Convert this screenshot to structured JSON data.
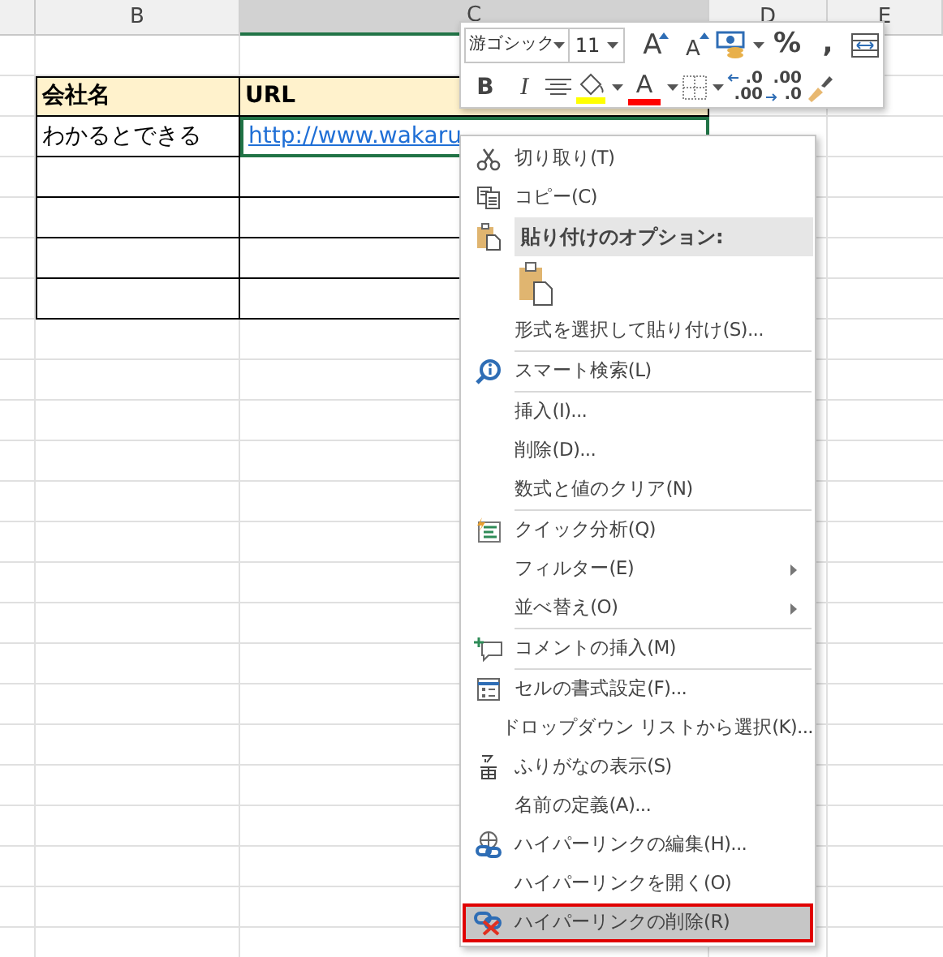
{
  "sheet": {
    "columns": [
      {
        "label": "B",
        "selected": false
      },
      {
        "label": "C",
        "selected": true
      },
      {
        "label": "D",
        "selected": false
      },
      {
        "label": "E",
        "selected": false
      }
    ],
    "table": {
      "header": [
        "会社名",
        "URL"
      ],
      "rows": [
        {
          "company": "わかるとできる",
          "url": "http://www.wakaru",
          "selected": true
        }
      ]
    }
  },
  "mini_toolbar": {
    "font": "游ゴシック",
    "size": "11",
    "row_1": [
      {
        "kind": "grow",
        "label": "A"
      },
      {
        "kind": "shrink",
        "label": "A"
      },
      {
        "kind": "accounting"
      },
      {
        "kind": "text",
        "label": "%"
      },
      {
        "kind": "text",
        "label": ","
      },
      {
        "kind": "wrap"
      }
    ],
    "row_2": [
      {
        "kind": "bold",
        "label": "B"
      },
      {
        "kind": "italic",
        "label": "I"
      },
      {
        "kind": "align"
      },
      {
        "kind": "fill",
        "color": "#ffff00"
      },
      {
        "kind": "fontcolor",
        "label": "A",
        "color": "#ff0000"
      },
      {
        "kind": "borders"
      },
      {
        "kind": "decimal-more",
        "top": ".0",
        "bottom": ".00"
      },
      {
        "kind": "decimal-less",
        "top": ".00",
        "bottom": ".0"
      },
      {
        "kind": "painter"
      }
    ]
  },
  "context_menu": [
    {
      "kind": "item",
      "label": "切り取り(T)",
      "selected": false
    },
    {
      "kind": "item",
      "label": "コピー(C)",
      "selected": false
    },
    {
      "kind": "header",
      "label": "貼り付けのオプション:"
    },
    {
      "kind": "paste"
    },
    {
      "kind": "item",
      "label": "形式を選択して貼り付け(S)...",
      "selected": false
    },
    {
      "kind": "separator"
    },
    {
      "kind": "item",
      "label": "スマート検索(L)",
      "selected": false
    },
    {
      "kind": "separator"
    },
    {
      "kind": "item",
      "label": "挿入(I)...",
      "selected": false
    },
    {
      "kind": "item",
      "label": "削除(D)...",
      "selected": false
    },
    {
      "kind": "item",
      "label": "数式と値のクリア(N)",
      "selected": false
    },
    {
      "kind": "separator"
    },
    {
      "kind": "item",
      "label": "クイック分析(Q)",
      "selected": false
    },
    {
      "kind": "item",
      "label": "フィルター(E)",
      "selected": false,
      "submenu": true
    },
    {
      "kind": "item",
      "label": "並べ替え(O)",
      "selected": false,
      "submenu": true
    },
    {
      "kind": "separator"
    },
    {
      "kind": "item",
      "label": "コメントの挿入(M)",
      "selected": false
    },
    {
      "kind": "separator"
    },
    {
      "kind": "item",
      "label": "セルの書式設定(F)...",
      "selected": false
    },
    {
      "kind": "item",
      "label": "ドロップダウン リストから選択(K)...",
      "selected": false
    },
    {
      "kind": "item",
      "label": "ふりがなの表示(S)",
      "selected": false
    },
    {
      "kind": "item",
      "label": "名前の定義(A)...",
      "selected": false
    },
    {
      "kind": "item",
      "label": "ハイパーリンクの編集(H)...",
      "selected": false
    },
    {
      "kind": "item",
      "label": "ハイパーリンクを開く(O)",
      "selected": false
    },
    {
      "kind": "item",
      "label": "ハイパーリンクの削除(R)",
      "selected": true
    }
  ]
}
